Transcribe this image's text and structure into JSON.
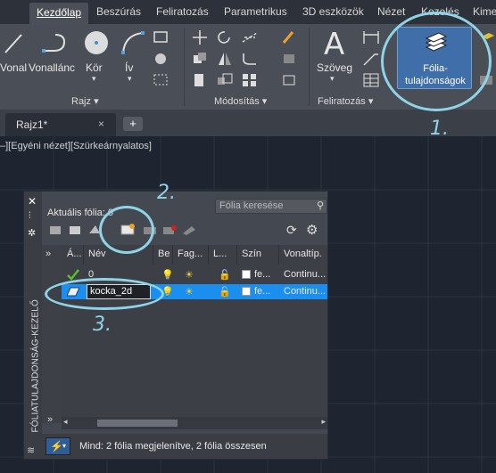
{
  "ribbon": {
    "tabs": [
      "Kezdőlap",
      "Beszúrás",
      "Feliratozás",
      "Parametrikus",
      "3D eszközök",
      "Nézet",
      "Kezelés",
      "Kime"
    ],
    "draw_tools": [
      "Vonal",
      "Vonallánc",
      "Kör",
      "Ív"
    ],
    "text_tool": "Szöveg",
    "layer_props_line1": "Fólia-",
    "layer_props_line2": "tulajdonságok",
    "panels": [
      "Rajz",
      "Módosítás",
      "Feliratozás"
    ]
  },
  "document": {
    "tab": "Rajz1*",
    "close": "×",
    "add": "+"
  },
  "viewport": {
    "label": "–][Egyéni nézet][Szürkeárnyalatos]"
  },
  "palette": {
    "side_title": "FÓLIATULAJDONSÁG-KEZELŐ",
    "current_layer_label": "Aktuális fólia: 0",
    "search_placeholder": "Fólia keresése",
    "columns": [
      "Á...",
      "Név",
      "Be",
      "Fag...",
      "L...",
      "Szín",
      "Vonaltíp."
    ],
    "rows": [
      {
        "name": "0",
        "color": "fe...",
        "linetype": "Continu...",
        "current": true
      },
      {
        "name": "kocka_2d",
        "color": "fe...",
        "linetype": "Continu...",
        "current": false,
        "selected": true
      }
    ],
    "status": "Mind: 2 fólia megjelenítve, 2 fólia összesen"
  },
  "annotations": [
    "1.",
    "2.",
    "3."
  ],
  "colors": {
    "accent": "#1a8ff0",
    "annotation": "#8fd3e6",
    "ribbon_bg": "#4a4e57"
  }
}
